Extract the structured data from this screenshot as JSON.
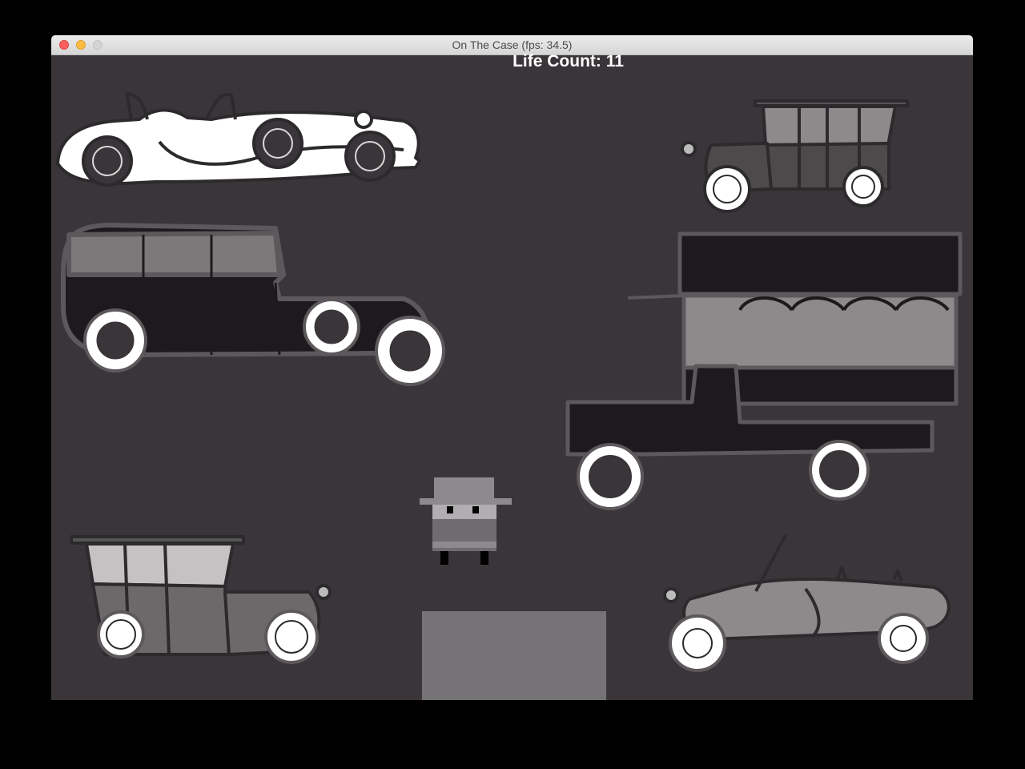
{
  "window": {
    "title": "On The Case (fps: 34.5)"
  },
  "hud": {
    "life_count": "Life Count: 11"
  },
  "colors": {
    "background": "#3a3539",
    "exit_zone": "#767376",
    "hud_text": "#ffffff"
  },
  "sprites": {
    "player": "detective-with-hat",
    "cars": [
      "white-roadster",
      "grey-town-car-top-right",
      "black-limousine",
      "double-decker-bus",
      "grey-town-car-bottom-left",
      "grey-convertible"
    ]
  }
}
